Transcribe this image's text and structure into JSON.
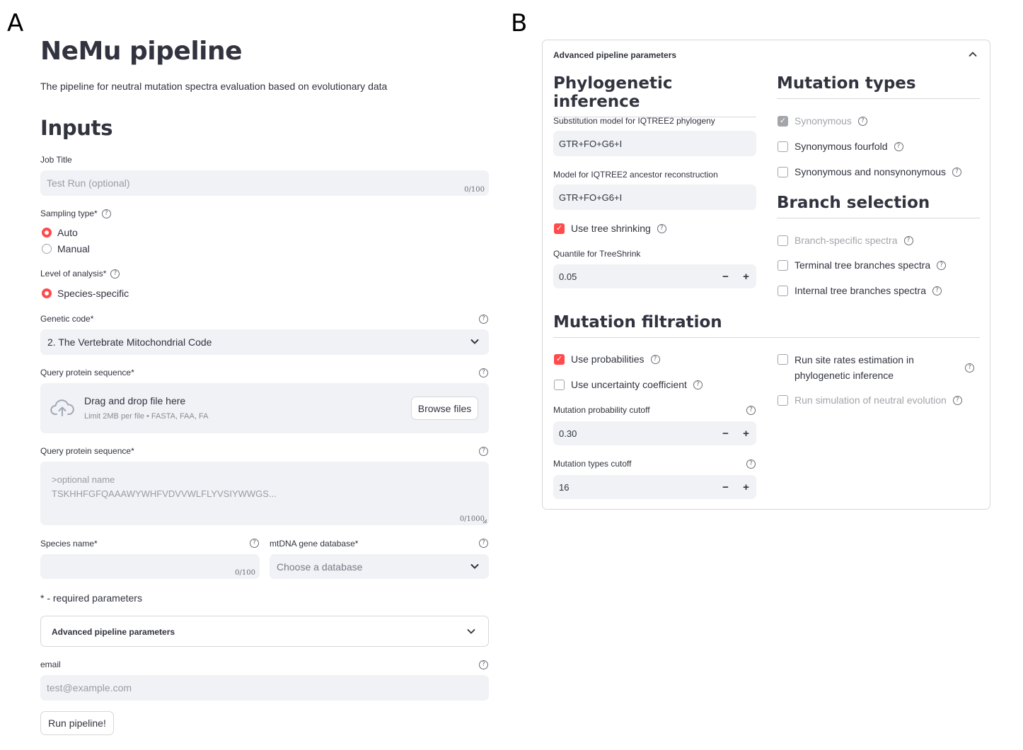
{
  "panel_labels": {
    "a": "A",
    "b": "B"
  },
  "app": {
    "title": "NeMu pipeline",
    "subtitle": "The pipeline for neutral mutation spectra evaluation based on evolutionary data"
  },
  "inputs": {
    "heading": "Inputs",
    "job_title": {
      "label": "Job Title",
      "placeholder": "Test Run (optional)",
      "counter": "0/100"
    },
    "sampling_type": {
      "label": "Sampling type*",
      "options": [
        "Auto",
        "Manual"
      ],
      "selected": "Auto"
    },
    "level_of_analysis": {
      "label": "Level of analysis*",
      "options": [
        "Species-specific"
      ],
      "selected": "Species-specific"
    },
    "genetic_code": {
      "label": "Genetic code*",
      "value": "2. The Vertebrate Mitochondrial Code"
    },
    "query_upload": {
      "label": "Query protein sequence*",
      "drop_text": "Drag and drop file here",
      "limit_text": "Limit 2MB per file • FASTA, FAA, FA",
      "browse_label": "Browse files"
    },
    "query_text": {
      "label": "Query protein sequence*",
      "placeholder_line1": ">optional name",
      "placeholder_line2": "TSKHHFGFQAAAWYWHFVDVVWLFLYVSIYWWGS...",
      "counter": "0/1000"
    },
    "species_name": {
      "label": "Species name*",
      "counter": "0/100"
    },
    "mtdna_db": {
      "label": "mtDNA gene database*",
      "placeholder": "Choose a database"
    },
    "required_note": "* - required parameters",
    "advanced_collapsed": {
      "title": "Advanced pipeline parameters"
    },
    "email": {
      "label": "email",
      "placeholder": "test@example.com"
    },
    "run_button": "Run pipeline!"
  },
  "advanced": {
    "title": "Advanced pipeline parameters",
    "phylo": {
      "heading": "Phylogenetic inference",
      "subst_model": {
        "label": "Substitution model for IQTREE2 phylogeny",
        "value": "GTR+FO+G6+I"
      },
      "anc_model": {
        "label": "Model for IQTREE2 ancestor reconstruction",
        "value": "GTR+FO+G6+I"
      },
      "tree_shrinking": {
        "label": "Use tree shrinking",
        "checked": true
      },
      "quantile": {
        "label": "Quantile for TreeShrink",
        "value": "0.05"
      }
    },
    "mutation_types": {
      "heading": "Mutation types",
      "items": [
        {
          "label": "Synonymous",
          "checked": true,
          "disabled": true
        },
        {
          "label": "Synonymous fourfold",
          "checked": false,
          "disabled": false
        },
        {
          "label": "Synonymous and nonsynonymous",
          "checked": false,
          "disabled": false
        }
      ]
    },
    "branch_selection": {
      "heading": "Branch selection",
      "items": [
        {
          "label": "Branch-specific spectra",
          "checked": false,
          "disabled": true
        },
        {
          "label": "Terminal tree branches spectra",
          "checked": false,
          "disabled": false
        },
        {
          "label": "Internal tree branches spectra",
          "checked": false,
          "disabled": false
        }
      ]
    },
    "filtration": {
      "heading": "Mutation filtration",
      "use_probabilities": {
        "label": "Use probabilities",
        "checked": true
      },
      "use_uncertainty": {
        "label": "Use uncertainty coefficient",
        "checked": false
      },
      "prob_cutoff": {
        "label": "Mutation probability cutoff",
        "value": "0.30"
      },
      "types_cutoff": {
        "label": "Mutation types cutoff",
        "value": "16"
      },
      "site_rates": {
        "label_line1": "Run site rates estimation in",
        "label_line2": "phylogenetic inference",
        "checked": false
      },
      "simulation": {
        "label": "Run simulation of neutral evolution",
        "checked": false,
        "disabled": true
      }
    }
  },
  "icons": {
    "help": "question-circle-icon",
    "upload": "cloud-upload-icon",
    "chevron_down": "chevron-down-icon",
    "chevron_up": "chevron-up-icon",
    "minus": "minus-icon",
    "plus": "plus-icon",
    "check": "checkmark-icon"
  },
  "colors": {
    "accent": "#ff4b4b",
    "input_bg": "#f0f2f6",
    "text": "#31333f",
    "muted": "#a3a5ab"
  }
}
